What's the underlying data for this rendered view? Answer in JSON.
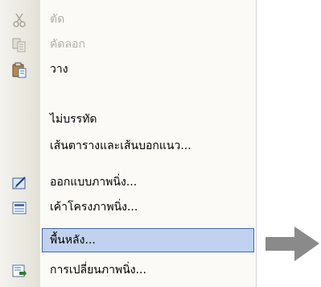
{
  "menu": {
    "items": [
      {
        "label": "ตัด",
        "icon": "scissors-icon",
        "disabled": true
      },
      {
        "label": "คัดลอก",
        "icon": "copy-icon",
        "disabled": true
      },
      {
        "label": "วาง",
        "icon": "paste-icon",
        "disabled": false
      },
      {
        "label": "ไม่บรรทัด",
        "icon": "",
        "disabled": false
      },
      {
        "label": "เส้นตารางและเส้นบอกแนว...",
        "icon": "",
        "disabled": false
      },
      {
        "label": "ออกแบบภาพนิ่ง...",
        "icon": "design-icon",
        "disabled": false
      },
      {
        "label": "เค้าโครงภาพนิ่ง...",
        "icon": "layout-icon",
        "disabled": false
      },
      {
        "label": "พื้นหลัง...",
        "icon": "",
        "disabled": false,
        "highlighted": true
      },
      {
        "label": "การเปลี่ยนภาพนิ่ง...",
        "icon": "transition-icon",
        "disabled": false
      }
    ]
  },
  "colors": {
    "highlight_bg": "#c1d2ee",
    "highlight_border": "#316ac5",
    "arrow": "#8a8a8a"
  },
  "annotation": {
    "arrow_icon": "right-arrow-icon"
  }
}
